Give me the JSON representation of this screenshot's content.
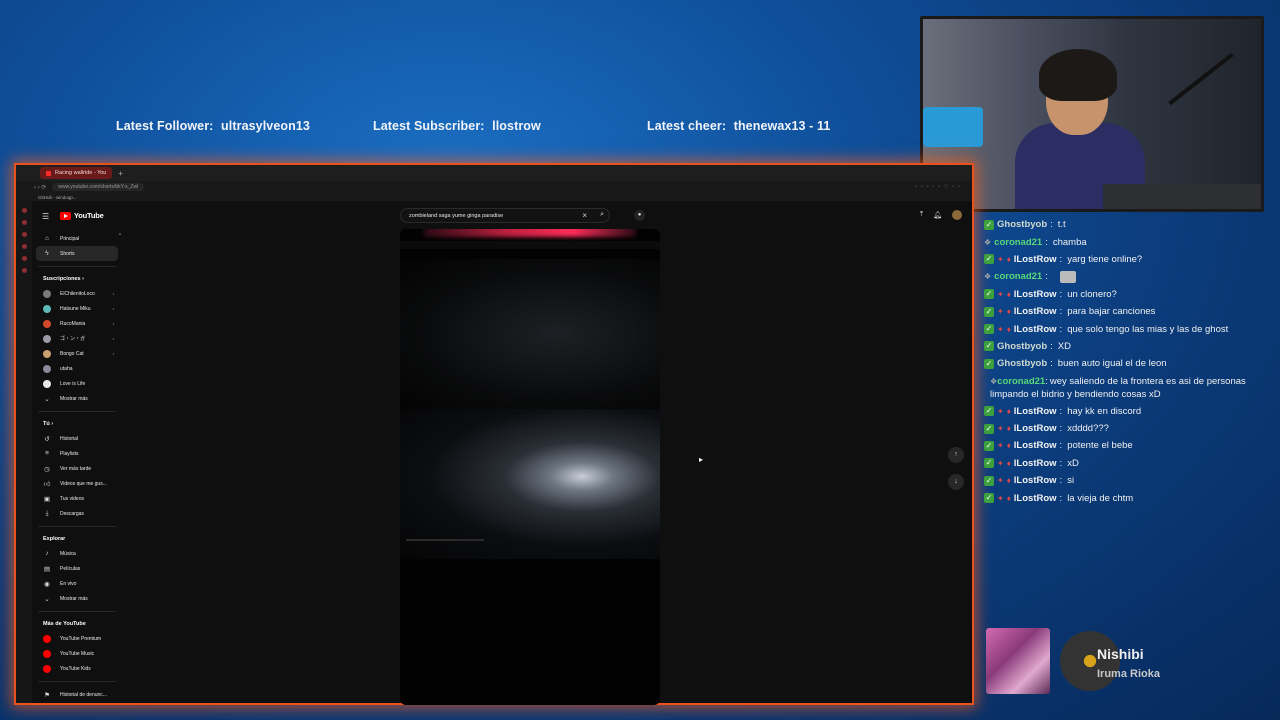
{
  "overlay": {
    "follower_label": "Latest Follower:",
    "follower_name": "ultrasylveon13",
    "subscriber_label": "Latest Subscriber:",
    "subscriber_name": "llostrow",
    "cheer_label": "Latest cheer:",
    "cheer_value": "thenewax13 - 11"
  },
  "browser": {
    "tab_title": "Racing wallride - You",
    "url": "www.youtube.com/shorts/bkY-x_Zwl",
    "bookmark": "GitHub - windoqp..."
  },
  "youtube": {
    "logo": "YouTube",
    "search_value": "zombieland saga yume ginga paradise",
    "sidebar": {
      "main": [
        {
          "label": "Principal",
          "icon": "home-icon"
        },
        {
          "label": "Shorts",
          "icon": "shorts-icon"
        }
      ],
      "subs_header": "Suscripciones",
      "subs": [
        {
          "label": "ElChilenitoLoco",
          "color": "#7a7a7a"
        },
        {
          "label": "Hatsune Miku",
          "color": "#5fb8b8"
        },
        {
          "label": "RucoMania",
          "color": "#d24a2a"
        },
        {
          "label": "ゴ・ン・ガ",
          "color": "#9a9aa8"
        },
        {
          "label": "Bongo Cat",
          "color": "#c8a070"
        },
        {
          "label": "utaha",
          "color": "#8a8a9a"
        },
        {
          "label": "Love is Life",
          "color": "#e8e8e8"
        }
      ],
      "show_more": "Mostrar más",
      "you_header": "Tú",
      "you": [
        {
          "label": "Historial",
          "icon": "history-icon"
        },
        {
          "label": "Playlists",
          "icon": "playlist-icon"
        },
        {
          "label": "Ver más tarde",
          "icon": "clock-icon"
        },
        {
          "label": "Videos que me gus...",
          "icon": "like-icon"
        },
        {
          "label": "Tus videos",
          "icon": "video-icon"
        },
        {
          "label": "Descargas",
          "icon": "download-icon"
        }
      ],
      "explore_header": "Explorar",
      "explore": [
        {
          "label": "Música",
          "icon": "music-icon"
        },
        {
          "label": "Películas",
          "icon": "film-icon"
        },
        {
          "label": "En vivo",
          "icon": "live-icon"
        }
      ],
      "show_more_2": "Mostrar más",
      "more_header": "Más de YouTube",
      "more": [
        {
          "label": "YouTube Premium"
        },
        {
          "label": "YouTube Music"
        },
        {
          "label": "YouTube Kids"
        }
      ],
      "report": "Historial de denunc..."
    }
  },
  "chat": [
    {
      "user": "Ghostbyob",
      "cls": "ghost",
      "badges": false,
      "msg": "t.t"
    },
    {
      "user": "coronad21",
      "cls": "coro",
      "badges": false,
      "msg": "chamba"
    },
    {
      "user": "lLostRow",
      "cls": "lost",
      "badges": true,
      "msg": "yarg tiene online?"
    },
    {
      "user": "coronad21",
      "cls": "coro",
      "badges": false,
      "msg": ""
    },
    {
      "user": "lLostRow",
      "cls": "lost",
      "badges": true,
      "msg": "un clonero?"
    },
    {
      "user": "lLostRow",
      "cls": "lost",
      "badges": true,
      "msg": "para bajar canciones"
    },
    {
      "user": "lLostRow",
      "cls": "lost",
      "badges": true,
      "msg": "que solo tengo las mias y las de ghost"
    },
    {
      "user": "Ghostbyob",
      "cls": "ghost",
      "badges": false,
      "msg": "XD"
    },
    {
      "user": "Ghostbyob",
      "cls": "ghost",
      "badges": false,
      "msg": "buen auto igual el de leon"
    },
    {
      "user": "coronad21",
      "cls": "coro",
      "badges": false,
      "msg": "wey saliendo de la frontera es asi de personas limpando el bidrio y bendiendo cosas xD",
      "wrap": true
    },
    {
      "user": "lLostRow",
      "cls": "lost",
      "badges": true,
      "msg": "hay kk en discord"
    },
    {
      "user": "lLostRow",
      "cls": "lost",
      "badges": true,
      "msg": "xdddd???"
    },
    {
      "user": "lLostRow",
      "cls": "lost",
      "badges": true,
      "msg": "potente el bebe"
    },
    {
      "user": "lLostRow",
      "cls": "lost",
      "badges": true,
      "msg": "xD"
    },
    {
      "user": "lLostRow",
      "cls": "lost",
      "badges": true,
      "msg": "si"
    },
    {
      "user": "lLostRow",
      "cls": "lost",
      "badges": true,
      "msg": "la vieja de chtm"
    }
  ],
  "now_playing": {
    "title": "Nishibi",
    "artist": "Iruma Rioka"
  },
  "colors": {
    "accent_border": "#e8521f",
    "yt_red": "#ff0000",
    "chat_green": "#58d87a"
  }
}
